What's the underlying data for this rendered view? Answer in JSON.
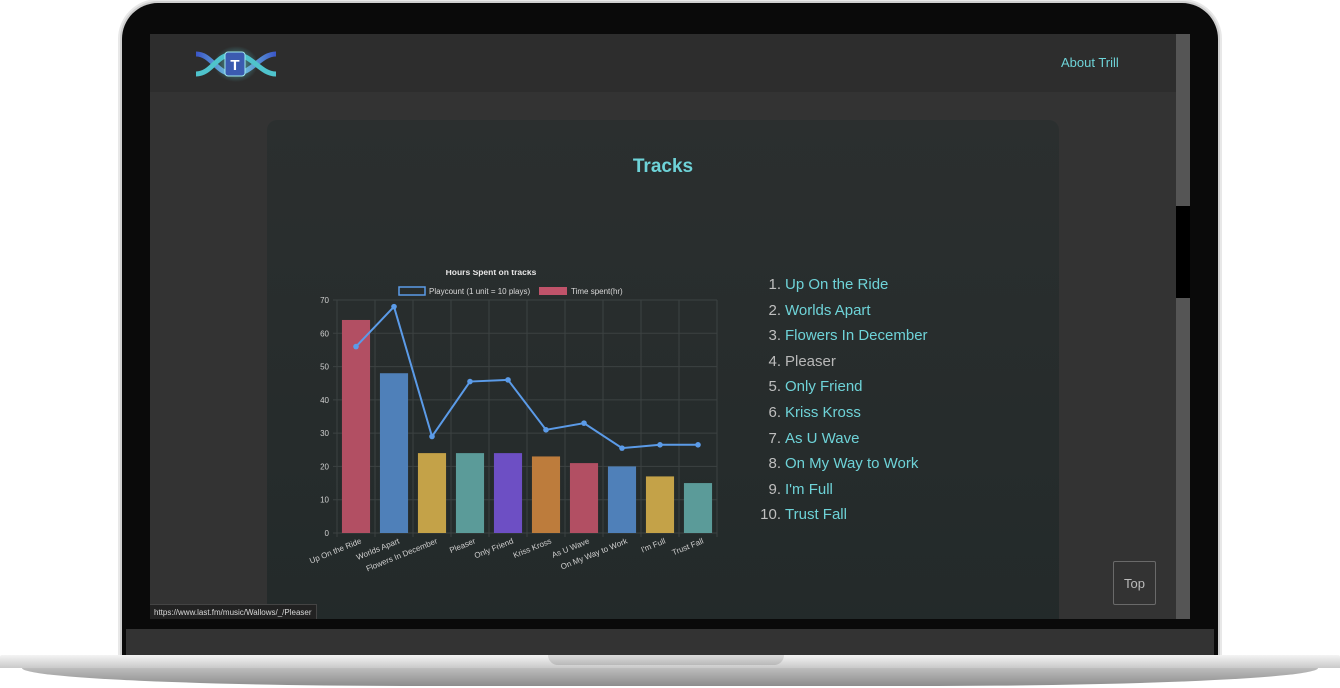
{
  "nav": {
    "about_label": "About Trill"
  },
  "logo": {
    "letter": "T"
  },
  "main": {
    "title": "Tracks",
    "tracks": [
      {
        "num": "1.",
        "name": "Up On the Ride",
        "visited": false
      },
      {
        "num": "2.",
        "name": "Worlds Apart",
        "visited": false
      },
      {
        "num": "3.",
        "name": "Flowers In December",
        "visited": false
      },
      {
        "num": "4.",
        "name": "Pleaser",
        "visited": true
      },
      {
        "num": "5.",
        "name": "Only Friend",
        "visited": false
      },
      {
        "num": "6.",
        "name": "Kriss Kross",
        "visited": false
      },
      {
        "num": "7.",
        "name": "As U Wave",
        "visited": false
      },
      {
        "num": "8.",
        "name": "On My Way to Work",
        "visited": false
      },
      {
        "num": "9.",
        "name": "I'm Full",
        "visited": false
      },
      {
        "num": "10.",
        "name": "Trust Fall",
        "visited": false
      }
    ]
  },
  "top_button": {
    "label": "Top"
  },
  "status_bar": {
    "url": "https://www.last.fm/music/Wallows/_/Pleaser"
  },
  "colors": {
    "accent": "#6ed3d8",
    "line": "#5b9be8"
  },
  "chart_data": {
    "type": "bar",
    "title": "Hours Spent on tracks",
    "categories": [
      "Up On the Ride",
      "Worlds Apart",
      "Flowers In December",
      "Pleaser",
      "Only Friend",
      "Kriss Kross",
      "As U Wave",
      "On My Way to Work",
      "I'm Full",
      "Trust Fall"
    ],
    "series": [
      {
        "name": "Playcount (1 unit = 10 plays)",
        "type": "line",
        "color": "#5b9be8",
        "values": [
          56,
          68,
          29,
          45.5,
          46,
          31,
          33,
          25.5,
          26.5,
          26.5
        ]
      },
      {
        "name": "Time spent(hr)",
        "type": "bar",
        "legend_color": "#c0536a",
        "values": [
          64,
          48,
          24,
          24,
          24,
          23,
          21,
          20,
          17,
          15
        ],
        "bar_colors": [
          "#b24f63",
          "#4f80b9",
          "#c4a248",
          "#5b9b99",
          "#6d4fc4",
          "#bd7c3c",
          "#b24f63",
          "#4f80b9",
          "#c4a248",
          "#5b9b99"
        ]
      }
    ],
    "ylim": [
      0,
      70
    ],
    "yticks": [
      0,
      10,
      20,
      30,
      40,
      50,
      60,
      70
    ],
    "legend": "top",
    "grid": true
  }
}
